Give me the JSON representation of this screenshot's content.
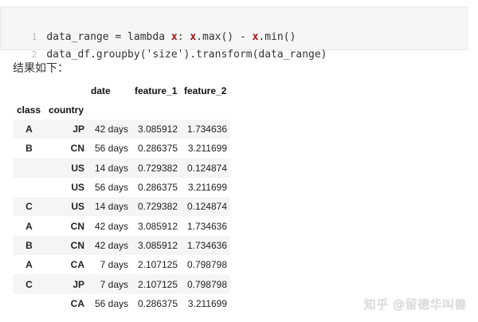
{
  "code": {
    "lines": [
      {
        "num": "1",
        "parts": [
          "data_range = lambda ",
          "x",
          ": ",
          "x",
          ".max() - ",
          "x",
          ".min()"
        ]
      },
      {
        "num": "2",
        "text": "data_df.groupby('size').transform(data_range)"
      }
    ]
  },
  "result_label": "结果如下：",
  "table": {
    "col_headers": [
      "date",
      "feature_1",
      "feature_2"
    ],
    "index_headers": [
      "class",
      "country"
    ],
    "rows": [
      {
        "class": "A",
        "country": "JP",
        "date": "42 days",
        "f1": "3.085912",
        "f2": "1.734636"
      },
      {
        "class": "B",
        "country": "CN",
        "date": "56 days",
        "f1": "0.286375",
        "f2": "3.211699"
      },
      {
        "class": "",
        "country": "US",
        "date": "14 days",
        "f1": "0.729382",
        "f2": "0.124874"
      },
      {
        "class": "",
        "country": "US",
        "date": "56 days",
        "f1": "0.286375",
        "f2": "3.211699"
      },
      {
        "class": "C",
        "country": "US",
        "date": "14 days",
        "f1": "0.729382",
        "f2": "0.124874"
      },
      {
        "class": "A",
        "country": "CN",
        "date": "42 days",
        "f1": "3.085912",
        "f2": "1.734636"
      },
      {
        "class": "B",
        "country": "CN",
        "date": "42 days",
        "f1": "3.085912",
        "f2": "1.734636"
      },
      {
        "class": "A",
        "country": "CA",
        "date": "7 days",
        "f1": "2.107125",
        "f2": "0.798798"
      },
      {
        "class": "C",
        "country": "JP",
        "date": "7 days",
        "f1": "2.107125",
        "f2": "0.798798"
      },
      {
        "class": "",
        "country": "CA",
        "date": "56 days",
        "f1": "0.286375",
        "f2": "3.211699"
      }
    ]
  },
  "watermark": "知乎 @留德华叫兽"
}
